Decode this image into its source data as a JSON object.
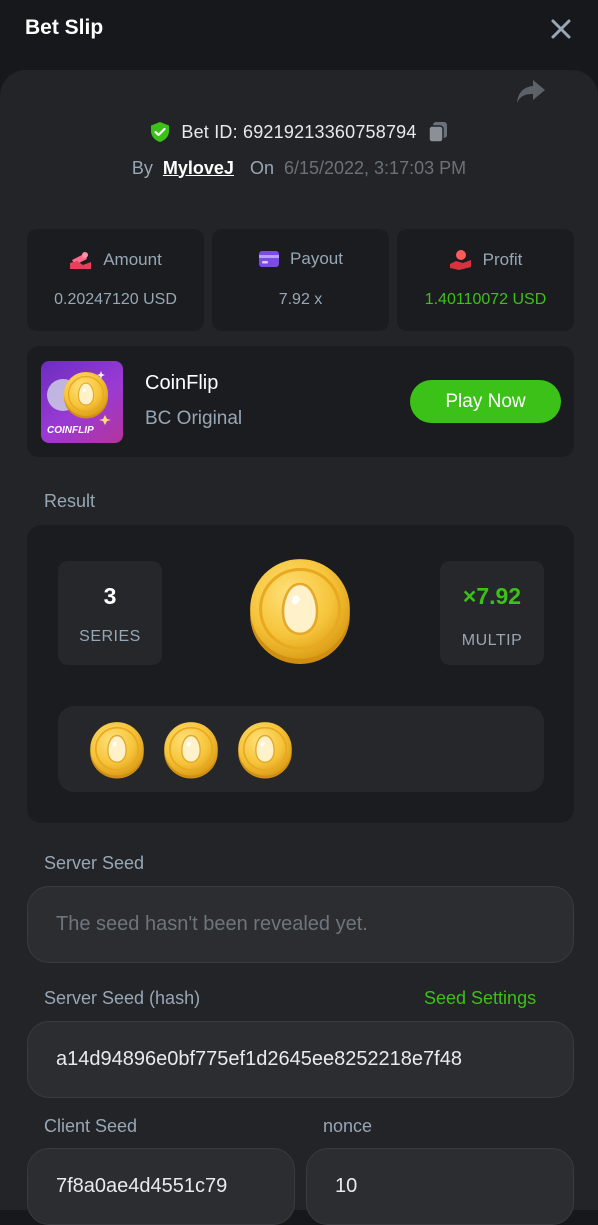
{
  "header": {
    "title": "Bet Slip"
  },
  "bet": {
    "id_text": "Bet ID: 69219213360758794",
    "by_label": "By",
    "user": "MyloveJ",
    "on_label": "On",
    "date": "6/15/2022, 3:17:03 PM"
  },
  "stats": [
    {
      "label": "Amount",
      "value": "0.20247120 USD",
      "icon": "money-bag-icon"
    },
    {
      "label": "Payout",
      "value": "7.92 x",
      "icon": "card-icon"
    },
    {
      "label": "Profit",
      "value": "1.40110072 USD",
      "icon": "hand-coin-icon"
    }
  ],
  "game": {
    "thumb_label": "COINFLIP",
    "name": "CoinFlip",
    "subtitle": "BC Original",
    "play_label": "Play Now"
  },
  "result": {
    "label": "Result",
    "series_value": "3",
    "series_label": "SERIES",
    "multiplier_value": "×7.92",
    "multiplier_label": "MULTIP",
    "coin_count": 3
  },
  "seeds": {
    "server_label": "Server Seed",
    "server_placeholder": "The seed hasn't been revealed yet.",
    "hash_label": "Server Seed (hash)",
    "seed_settings": "Seed Settings",
    "hash_value": "a14d94896e0bf775ef1d2645ee8252218e7f48",
    "client_label": "Client Seed",
    "client_value": "7f8a0ae4d4551c79",
    "nonce_label": "nonce",
    "nonce_value": "10"
  },
  "colors": {
    "accent_green": "#3bc117",
    "text_muted": "#98a7b5",
    "panel_bg": "#232427",
    "card_bg": "#1b1c1f",
    "coin_gold": "#f6c43a"
  }
}
